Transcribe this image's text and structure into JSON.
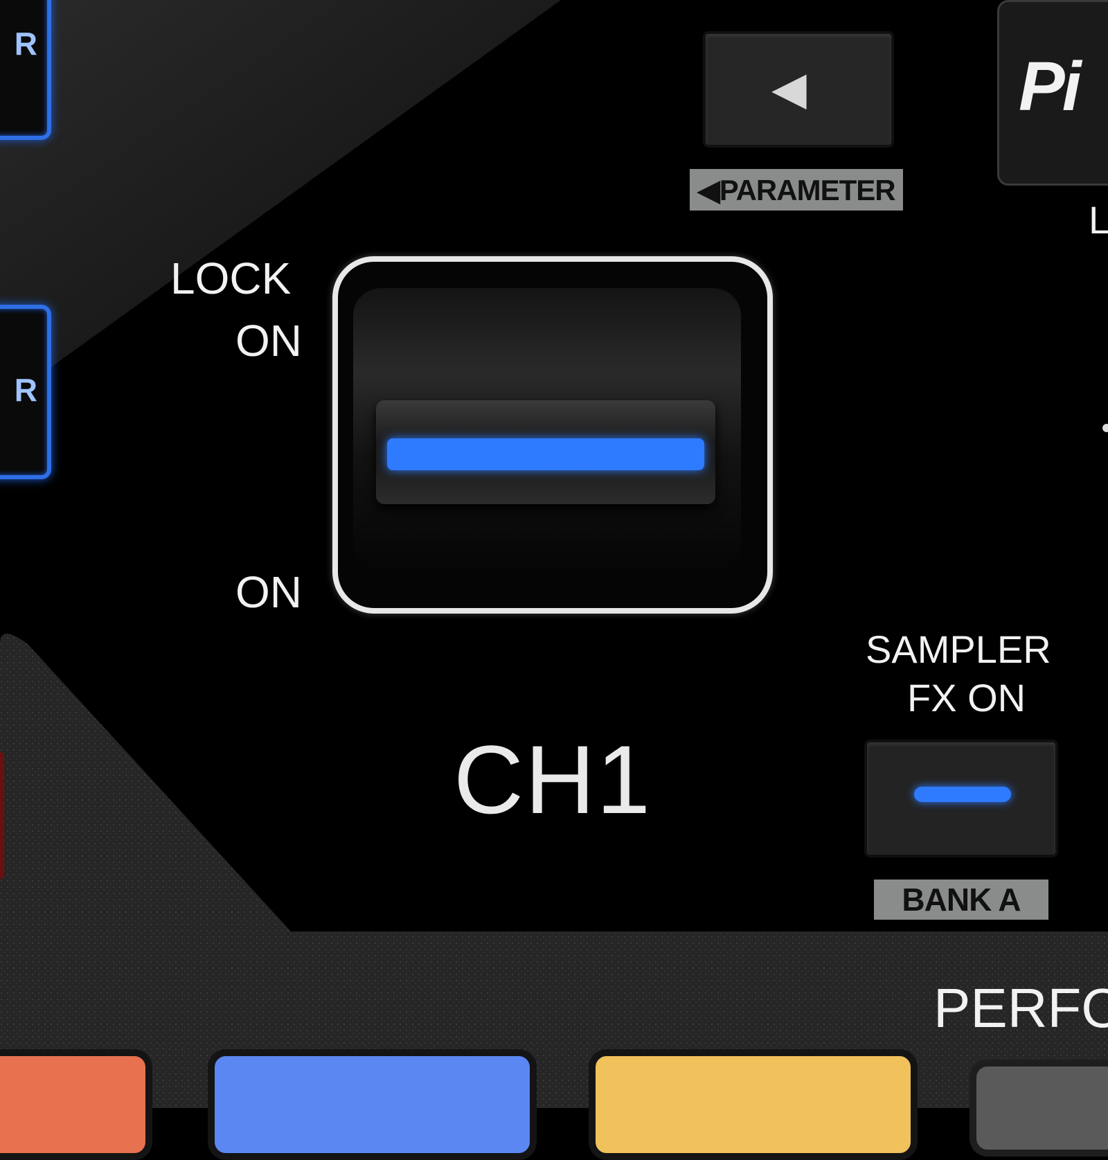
{
  "side_buttons": [
    {
      "letter": "R"
    },
    {
      "letter": "R"
    }
  ],
  "parameter_button": {
    "arrow": "◀",
    "label": "◀PARAMETER"
  },
  "logo": {
    "text": "Pi"
  },
  "right_edge_letter": "L",
  "lock_on_label": {
    "line1": "LOCK",
    "line2": "ON"
  },
  "on_label": "ON",
  "channel_label": "CH1",
  "sampler_fx": {
    "line1": "SAMPLER",
    "line2": "FX ON",
    "bank_label": "BANK A"
  },
  "performance_heading": "PERFO",
  "colors": {
    "accent_blue": "#2f7bff",
    "pad_orange": "#e8714f",
    "pad_blue": "#5b87f2",
    "pad_yellow": "#f1c15b",
    "pad_red": "#6b0f10"
  }
}
